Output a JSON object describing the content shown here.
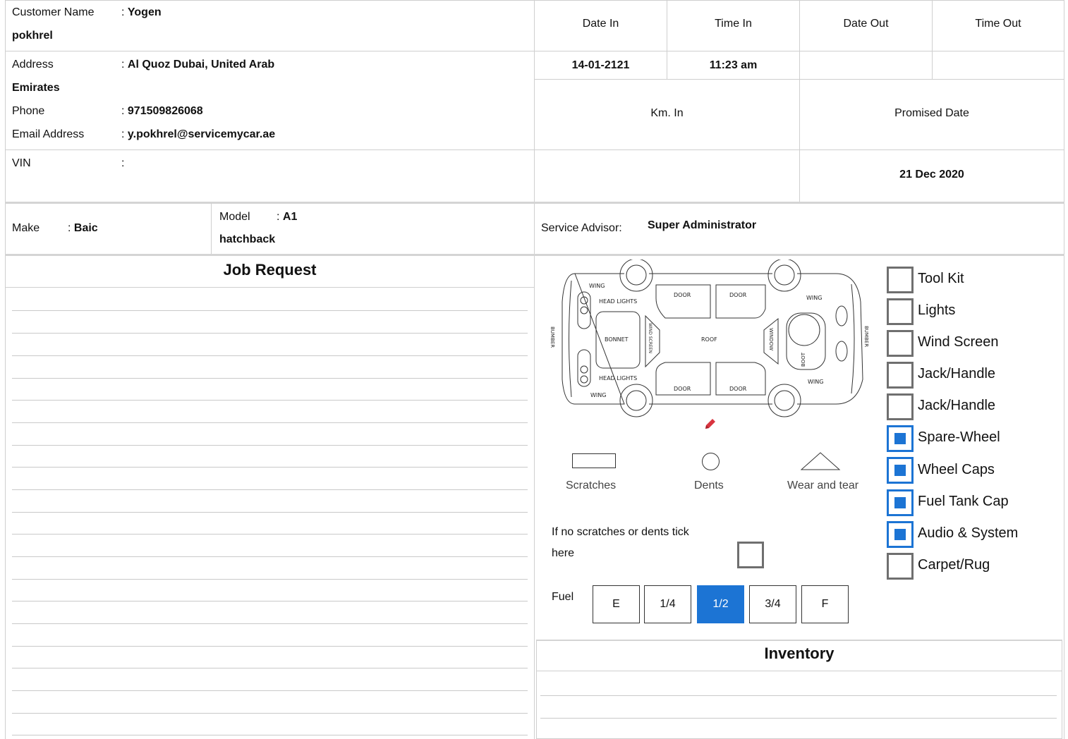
{
  "customer": {
    "name_label": "Customer Name",
    "name_value_line1": "Yogen",
    "name_value_line2": "pokhrel",
    "address_label": "Address",
    "address_value_line1": "Al Quoz Dubai, United Arab",
    "address_value_line2": "Emirates",
    "phone_label": "Phone",
    "phone_value": "971509826068",
    "email_label": "Email Address",
    "email_value": "y.pokhrel@servicemycar.ae",
    "vin_label": "VIN",
    "vin_value": "",
    "colon": ":"
  },
  "dates": {
    "date_in_label": "Date In",
    "time_in_label": "Time In",
    "date_out_label": "Date Out",
    "time_out_label": "Time Out",
    "date_in_value": "14-01-2121",
    "time_in_value": "11:23 am",
    "date_out_value": "",
    "time_out_value": "",
    "km_in_label": "Km. In",
    "km_in_value": "",
    "promised_label": "Promised Date",
    "promised_value": "21 Dec 2020"
  },
  "vehicle": {
    "make_label": "Make",
    "make_value": "Baic",
    "model_label": "Model",
    "model_value_line1": "A1",
    "model_value_line2": "hatchback",
    "advisor_label": "Service Advisor:",
    "advisor_value": "Super Administrator"
  },
  "job_request": {
    "title": "Job Request"
  },
  "diagram": {
    "wing_tl": "WING",
    "wing_tr": "WING",
    "wing_bl": "WING",
    "wing_br": "WING",
    "head_top": "HEAD LIGHTS",
    "head_bottom": "HEAD LIGHTS",
    "door_tl": "DOOR",
    "door_tr": "DOOR",
    "door_bl": "DOOR",
    "door_br": "DOOR",
    "bonnet": "BONNET",
    "wind_screen": "WIND SCREEN",
    "roof": "ROOF",
    "window": "WINDOW",
    "boot": "BOOT",
    "bumber_left": "BUMBER",
    "bumber_right": "BUMBER"
  },
  "legend": {
    "scratches": "Scratches",
    "dents": "Dents",
    "wear": "Wear and tear",
    "no_damage_line1": "If no scratches or dents tick",
    "no_damage_line2": "here",
    "no_damage_checked": false
  },
  "fuel": {
    "label": "Fuel",
    "levels": [
      "E",
      "1/4",
      "1/2",
      "3/4",
      "F"
    ],
    "selected": "1/2"
  },
  "checklist": [
    {
      "label": "Tool Kit",
      "checked": false
    },
    {
      "label": "Lights",
      "checked": false
    },
    {
      "label": "Wind Screen",
      "checked": false
    },
    {
      "label": "Jack/Handle",
      "checked": false
    },
    {
      "label": "Jack/Handle",
      "checked": false
    },
    {
      "label": "Spare-Wheel",
      "checked": true
    },
    {
      "label": "Wheel Caps",
      "checked": true
    },
    {
      "label": "Fuel Tank Cap",
      "checked": true
    },
    {
      "label": "Audio & System",
      "checked": true
    },
    {
      "label": "Carpet/Rug",
      "checked": false
    }
  ],
  "inventory": {
    "title": "Inventory"
  },
  "colors": {
    "accent": "#1c74d4",
    "pencil": "#d9343f",
    "border": "#cfcfcf"
  },
  "icons": {
    "pencil": "pencil-icon"
  }
}
